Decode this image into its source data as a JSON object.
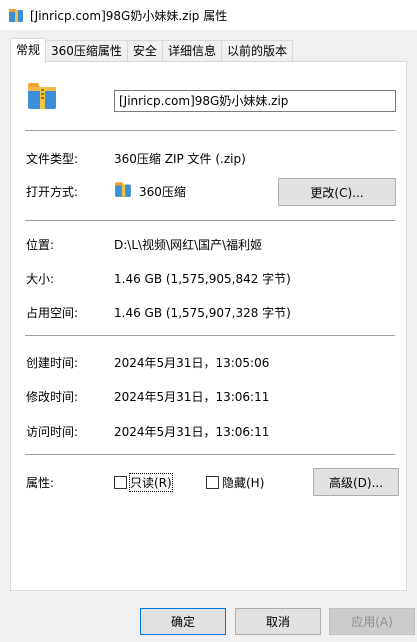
{
  "window": {
    "title": "[Jinricp.com]98G奶小妹妹.zip 属性"
  },
  "tabs": [
    {
      "label": "常规"
    },
    {
      "label": "360压缩属性"
    },
    {
      "label": "安全"
    },
    {
      "label": "详细信息"
    },
    {
      "label": "以前的版本"
    }
  ],
  "general": {
    "file_name": "[Jinricp.com]98G奶小妹妹.zip",
    "file_type_label": "文件类型:",
    "file_type_value": "360压缩 ZIP 文件 (.zip)",
    "open_with_label": "打开方式:",
    "open_with_value": "360压缩",
    "change_button": "更改(C)...",
    "location_label": "位置:",
    "location_value": "D:\\L\\视频\\网红\\国产\\福利姬",
    "size_label": "大小:",
    "size_value": "1.46 GB (1,575,905,842 字节)",
    "size_on_disk_label": "占用空间:",
    "size_on_disk_value": "1.46 GB (1,575,907,328 字节)",
    "created_label": "创建时间:",
    "created_value": "2024年5月31日，13:05:06",
    "modified_label": "修改时间:",
    "modified_value": "2024年5月31日，13:06:11",
    "accessed_label": "访问时间:",
    "accessed_value": "2024年5月31日，13:06:11",
    "attributes_label": "属性:",
    "readonly_label": "只读(R)",
    "readonly_checked": false,
    "hidden_label": "隐藏(H)",
    "hidden_checked": false,
    "advanced_button": "高级(D)..."
  },
  "footer": {
    "ok_button": "确定",
    "cancel_button": "取消",
    "apply_button": "应用(A)"
  },
  "colors": {
    "window_bg": "#f0f0f0",
    "panel_bg": "#ffffff",
    "primary_border": "#0078d7",
    "zip_blue": "#3a8fd8",
    "zip_orange": "#f0a030"
  }
}
